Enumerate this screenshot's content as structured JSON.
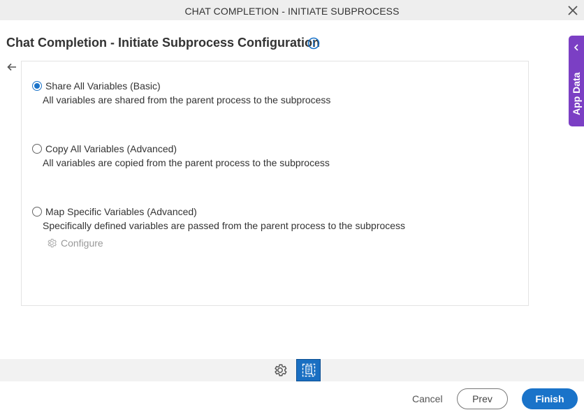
{
  "window": {
    "title": "CHAT COMPLETION - INITIATE SUBPROCESS"
  },
  "page": {
    "title": "Chat Completion - Initiate Subprocess Configuration"
  },
  "options": [
    {
      "label": "Share All Variables (Basic)",
      "description": "All variables are shared from the parent process to the subprocess",
      "checked": true
    },
    {
      "label": "Copy All Variables (Advanced)",
      "description": "All variables are copied from the parent process to the subprocess",
      "checked": false
    },
    {
      "label": "Map Specific Variables (Advanced)",
      "description": "Specifically defined variables are passed from the parent process to the subprocess",
      "checked": false
    }
  ],
  "configure": {
    "label": "Configure"
  },
  "side_tab": {
    "label": "App Data"
  },
  "footer": {
    "cancel_label": "Cancel",
    "prev_label": "Prev",
    "finish_label": "Finish"
  },
  "colors": {
    "accent": "#1a73c9",
    "side_tab": "#7b3fc4"
  },
  "icons": {
    "close": "close-icon",
    "info": "info-icon",
    "back": "back-arrow-icon",
    "configure": "gear-icon",
    "toolbar_settings": "gear-icon",
    "toolbar_active": "document-map-icon",
    "side_tab_chevron": "chevron-left-icon"
  }
}
